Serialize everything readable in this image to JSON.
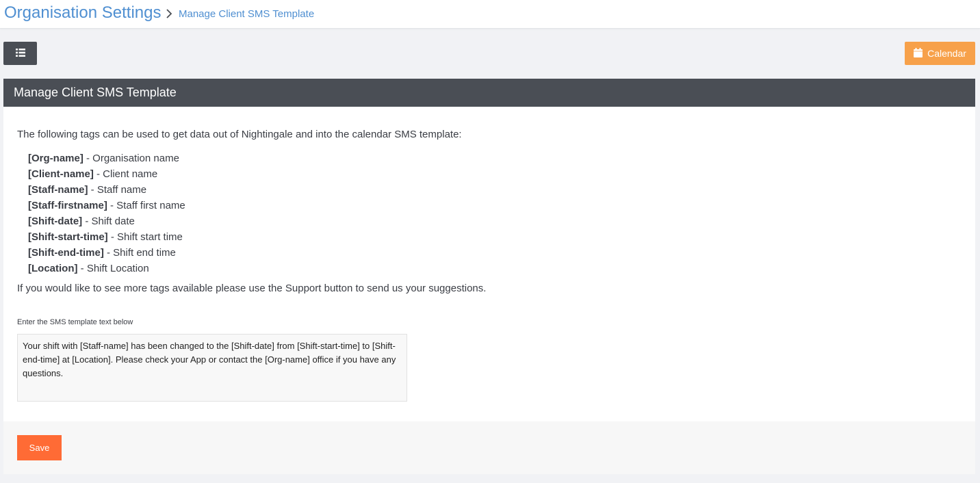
{
  "header": {
    "title": "Organisation Settings",
    "breadcrumb_current": "Manage Client SMS Template",
    "breadcrumb_icon": "chevron-right-icon"
  },
  "toolbar": {
    "menu_icon": "list-icon",
    "calendar_label": "Calendar",
    "calendar_icon": "calendar-icon",
    "calendar_color": "#f7a14a"
  },
  "panel": {
    "title": "Manage Client SMS Template",
    "intro": "The following tags can be used to get data out of Nightingale and into the calendar SMS template:",
    "tags": [
      {
        "tag": "[Org-name]",
        "desc": " - Organisation name"
      },
      {
        "tag": "[Client-name]",
        "desc": " - Client name"
      },
      {
        "tag": "[Staff-name]",
        "desc": " - Staff name"
      },
      {
        "tag": "[Staff-firstname]",
        "desc": " - Staff first name"
      },
      {
        "tag": "[Shift-date]",
        "desc": " - Shift date"
      },
      {
        "tag": "[Shift-start-time]",
        "desc": " - Shift start time"
      },
      {
        "tag": "[Shift-end-time]",
        "desc": " - Shift end time"
      },
      {
        "tag": "[Location]",
        "desc": " - Shift Location"
      }
    ],
    "outro": "If you would like to see more tags available please use the Support button to send us your suggestions.",
    "field_label": "Enter the SMS template text below",
    "template_text": "Your shift with [Staff-name] has been changed to the [Shift-date] from [Shift-start-time] to [Shift-end-time] at [Location]. Please check your App or contact the [Org-name] office if you have any questions."
  },
  "footer": {
    "save_label": "Save",
    "save_color": "#ff6b35"
  },
  "colors": {
    "link_blue": "#4f8fd1",
    "header_dark": "#4a4e55"
  }
}
